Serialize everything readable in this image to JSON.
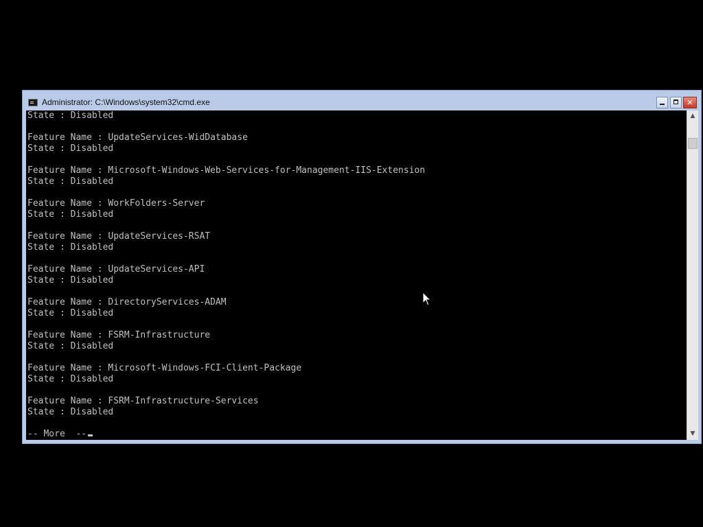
{
  "window": {
    "title": "Administrator: C:\\Windows\\system32\\cmd.exe",
    "close_glyph": "✕"
  },
  "console": {
    "lines": [
      "State : Disabled",
      "",
      "Feature Name : UpdateServices-WidDatabase",
      "State : Disabled",
      "",
      "Feature Name : Microsoft-Windows-Web-Services-for-Management-IIS-Extension",
      "State : Disabled",
      "",
      "Feature Name : WorkFolders-Server",
      "State : Disabled",
      "",
      "Feature Name : UpdateServices-RSAT",
      "State : Disabled",
      "",
      "Feature Name : UpdateServices-API",
      "State : Disabled",
      "",
      "Feature Name : DirectoryServices-ADAM",
      "State : Disabled",
      "",
      "Feature Name : FSRM-Infrastructure",
      "State : Disabled",
      "",
      "Feature Name : Microsoft-Windows-FCI-Client-Package",
      "State : Disabled",
      "",
      "Feature Name : FSRM-Infrastructure-Services",
      "State : Disabled",
      "",
      "-- More  --"
    ]
  },
  "scrollbar": {
    "up_glyph": "▲",
    "down_glyph": "▼"
  },
  "colors": {
    "console_text": "#c0c0c0",
    "console_bg": "#000000",
    "frame": "#b9cbe8",
    "close_button": "#c43a2a"
  }
}
